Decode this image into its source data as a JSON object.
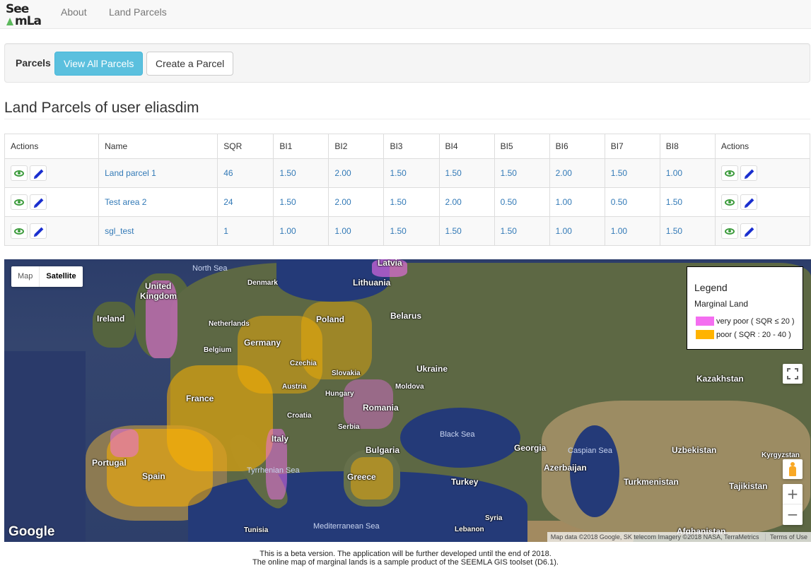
{
  "navbar": {
    "logo_line1": "See",
    "logo_line2": "mLa",
    "links": [
      "About",
      "Land Parcels"
    ]
  },
  "toolbar": {
    "label": "Parcels",
    "view_all_label": "View All Parcels",
    "create_label": "Create a Parcel"
  },
  "page_title": "Land Parcels of user eliasdim",
  "table": {
    "headers": [
      "Actions",
      "Name",
      "SQR",
      "BI1",
      "BI2",
      "BI3",
      "BI4",
      "BI5",
      "BI6",
      "BI7",
      "BI8",
      "Actions"
    ],
    "rows": [
      {
        "name": "Land parcel 1",
        "sqr": "46",
        "bi": [
          "1.50",
          "2.00",
          "1.50",
          "1.50",
          "1.50",
          "2.00",
          "1.50",
          "1.00"
        ]
      },
      {
        "name": "Test area 2",
        "sqr": "24",
        "bi": [
          "1.50",
          "2.00",
          "1.50",
          "2.00",
          "0.50",
          "1.00",
          "0.50",
          "1.50"
        ]
      },
      {
        "name": "sgl_test",
        "sqr": "1",
        "bi": [
          "1.00",
          "1.00",
          "1.50",
          "1.50",
          "1.50",
          "1.00",
          "1.00",
          "1.50"
        ]
      }
    ]
  },
  "map": {
    "type_map": "Map",
    "type_satellite": "Satellite",
    "legend": {
      "title": "Legend",
      "subtitle": "Marginal Land",
      "items": [
        {
          "label": "very poor ( SQR ≤ 20 )",
          "color": "#f46ef0"
        },
        {
          "label": "poor ( SQR : 20 - 40 )",
          "color": "#ffb300"
        }
      ]
    },
    "labels": {
      "north_sea": "North Sea",
      "latvia": "Latvia",
      "denmark": "Denmark",
      "lithuania": "Lithuania",
      "united_kingdom_1": "United",
      "united_kingdom_2": "Kingdom",
      "ireland": "Ireland",
      "belarus": "Belarus",
      "poland": "Poland",
      "netherlands": "Netherlands",
      "germany": "Germany",
      "belgium": "Belgium",
      "czechia": "Czechia",
      "slovakia": "Slovakia",
      "ukraine": "Ukraine",
      "kazakhstan": "Kazakhstan",
      "austria": "Austria",
      "moldova": "Moldova",
      "hungary": "Hungary",
      "france": "France",
      "romania": "Romania",
      "croatia": "Croatia",
      "serbia": "Serbia",
      "black_sea": "Black Sea",
      "italy": "Italy",
      "bulgaria": "Bulgaria",
      "georgia": "Georgia",
      "caspian_sea": "Caspian Sea",
      "uzbekistan": "Uzbekistan",
      "kyrgyzstan": "Kyrgyzstan",
      "portugal": "Portugal",
      "azerbaijan": "Azerbaijan",
      "tyrrhenian_sea": "Tyrrhenian Sea",
      "spain": "Spain",
      "greece": "Greece",
      "turkey": "Turkey",
      "turkmenistan": "Turkmenistan",
      "tajikistan": "Tajikistan",
      "syria": "Syria",
      "tunisia": "Tunisia",
      "mediterranean_sea": "Mediterranean Sea",
      "lebanon": "Lebanon",
      "afghanistan": "Afghanistan"
    },
    "google": "Google",
    "attribution": "Map data ©2018 Google, SK telecom Imagery ©2018 NASA, TerraMetrics",
    "terms": "Terms of Use"
  },
  "footer": {
    "line1": "This is a beta version. The application will be further developed until the end of 2018.",
    "line2": "The online map of marginal lands is a sample product of the SEEMLA GIS toolset (D6.1)."
  }
}
